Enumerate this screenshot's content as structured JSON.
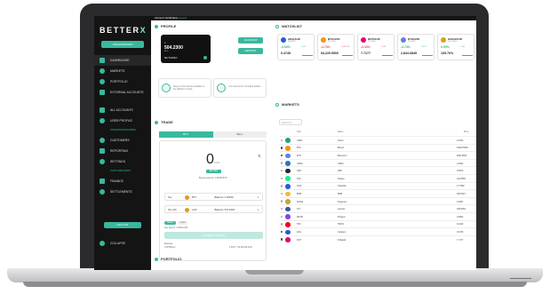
{
  "topbar": {
    "account_label": "Account Verification",
    "account_level": "Level1"
  },
  "sidebar": {
    "brand": "BETTER",
    "brand_mark": "X",
    "org_button": "ORGANISATION",
    "items": [
      {
        "label": "DASHBOARD",
        "active": true
      },
      {
        "label": "MARKETS"
      },
      {
        "label": "PORTFOLIO"
      },
      {
        "label": "EXTERNAL ACCOUNTS"
      }
    ],
    "items2": [
      {
        "label": "ALL ACCOUNTS"
      },
      {
        "label": "USER PROFILE"
      }
    ],
    "section_org": "ORGANISATION ADMIN",
    "items3": [
      {
        "label": "CUSTOMERS"
      },
      {
        "label": "REPORTING"
      },
      {
        "label": "SETTINGS"
      }
    ],
    "section_platform": "PLATFORM ADMIN",
    "items4": [
      {
        "label": "FINANCE"
      },
      {
        "label": "SETTLEMENTS"
      }
    ],
    "logout": "LOG OUT",
    "collapse": "COLLAPSE"
  },
  "profile": {
    "title": "PROFILE",
    "card_small": "$",
    "card_amount": "504.2300",
    "card_sub": "AUD",
    "card_name": "BETTERMEX",
    "account_btn": "ACCOUNT",
    "deposit_btn": "DEPOSIT",
    "tip1": "Stay on more assets available on the platform to trade",
    "tip2": "Your account for compliant details"
  },
  "trade": {
    "title": "TRADE",
    "tab_buy": "BUY",
    "tab_sell": "SELL",
    "amount": "0",
    "amount_unit": "AUD",
    "badge": "BUYING",
    "buying_info": "Buying approx. 0.0000 BTC",
    "pay_label": "Pay",
    "pay_coin": "BTC",
    "pay_balance": "(Balance: 0.00000)",
    "paywith_label": "Pay with",
    "paywith_coin": "AUD",
    "paywith_balance": "(Balance: 504.2300)",
    "fee_tab_on": "Market",
    "fee_tab_off": "Limit",
    "fee_text": "Fee approx. 0.0000 AUD",
    "button": "TRADE & SETTLE",
    "estimate_label": "Estimate",
    "estimate_text": "0.00 Bitcoin",
    "rate_text": "1 BTC = 94,420.56 AUD"
  },
  "portfolio": {
    "title": "PORTFOLIO"
  },
  "watchlist": {
    "title": "WATCHLIST",
    "cards": [
      {
        "name": "ADA/AUD",
        "sub": "ADA/AUD",
        "change": "-3.00%",
        "change2": "-0.02",
        "price": "0.4745",
        "color": "#2a5ad8",
        "trend": "#2eb67d"
      },
      {
        "name": "BTC/AUD",
        "sub": "BTC/AUD",
        "change": "-4.73%",
        "change2": "-4,4k 35%",
        "price": "94,220.5500",
        "color": "#f2931a",
        "trend": "#e25555"
      },
      {
        "name": "DOT/AUD",
        "sub": "DOT/AUD",
        "change": "-3.33%",
        "change2": "-0.28",
        "price": "7.7177",
        "color": "#e6007a",
        "trend": "#e25555"
      },
      {
        "name": "ETH/AUD",
        "sub": "ETH/AUD",
        "change": "-3.74%",
        "change2": "-110.7",
        "price": "2,844.6845",
        "color": "#627eea",
        "trend": "#2eb67d"
      },
      {
        "name": "GOLD/AUD",
        "sub": "GOLD/AUD",
        "change": "0.00%",
        "change2": "0.00",
        "price": "105.70%",
        "color": "#d4a418",
        "trend": "#2eb67d"
      }
    ]
  },
  "markets": {
    "title": "MARKETS",
    "search_placeholder": "Search by...",
    "headers": {
      "coin": "Coin",
      "name": "Name",
      "price": "Price"
    },
    "rows": [
      {
        "coin": "USDT",
        "name": "Tether",
        "price": "1.5316",
        "color": "#26a17b",
        "fav": false
      },
      {
        "coin": "BTC",
        "name": "Bitcoin",
        "price": "94220.5500",
        "color": "#f2931a",
        "fav": true
      },
      {
        "coin": "ETH",
        "name": "Ethereum",
        "price": "2844.6845",
        "color": "#627eea",
        "fav": true
      },
      {
        "coin": "USDC",
        "name": "USDC",
        "price": "1.5292",
        "color": "#2775ca",
        "fav": false
      },
      {
        "coin": "XRP",
        "name": "XRP",
        "price": "0.8979",
        "color": "#23292f",
        "fav": false
      },
      {
        "coin": "SOL",
        "name": "Solana",
        "price": "224.8553",
        "color": "#14f195",
        "fav": false
      },
      {
        "coin": "LINK",
        "name": "Chainlink",
        "price": "17.7682",
        "color": "#2a5ada",
        "fav": false
      },
      {
        "coin": "BNB",
        "name": "BNB",
        "price": "930.5617",
        "color": "#f3ba2f",
        "fav": false
      },
      {
        "coin": "DOGE",
        "name": "Dogecoin",
        "price": "0.1887",
        "color": "#c2a633",
        "fav": false
      },
      {
        "coin": "LTC",
        "name": "Litecoin",
        "price": "108.8354",
        "color": "#345d9d",
        "fav": false
      },
      {
        "coin": "MATIC",
        "name": "Polygon",
        "price": "0.5844",
        "color": "#8247e5",
        "fav": false
      },
      {
        "coin": "TRX",
        "name": "TRON",
        "price": "0.2162",
        "color": "#ef0027",
        "fav": false
      },
      {
        "coin": "ADA",
        "name": "Cardano",
        "price": "0.4745",
        "color": "#2a5ad8",
        "fav": true
      },
      {
        "coin": "DOT",
        "name": "Polkadot",
        "price": "7.7177",
        "color": "#e6007a",
        "fav": true
      }
    ]
  }
}
